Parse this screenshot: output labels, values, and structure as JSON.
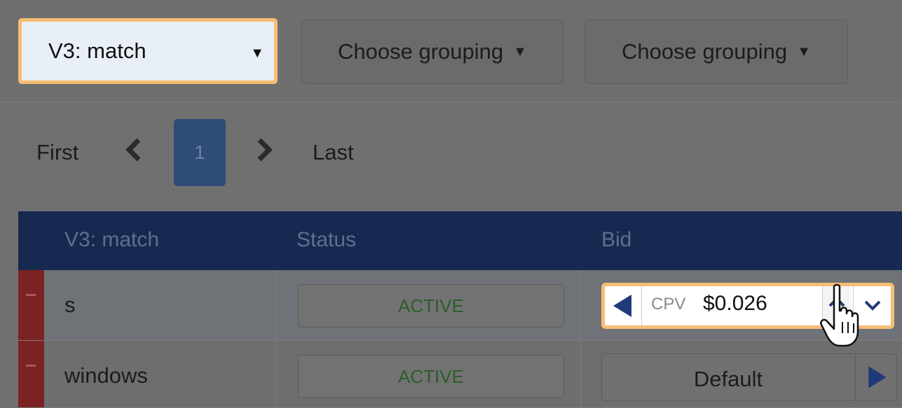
{
  "toolbar": {
    "version_select": "V3: match",
    "grouping_1": "Choose grouping",
    "grouping_2": "Choose grouping",
    "caret": "▼"
  },
  "pager": {
    "first": "First",
    "current": "1",
    "last": "Last"
  },
  "table": {
    "headers": [
      "V3: match",
      "Status",
      "Bid"
    ],
    "rows": [
      {
        "name": "s",
        "status": "ACTIVE",
        "bid_type": "CPV",
        "bid_value": "$0.026"
      },
      {
        "name": "windows",
        "status": "ACTIVE",
        "bid_label": "Default"
      }
    ]
  },
  "colors": {
    "header_bg": "#172951",
    "highlight": "#f6bd74",
    "status_text": "#2d5d2b",
    "remove_bar": "#7c2222"
  }
}
